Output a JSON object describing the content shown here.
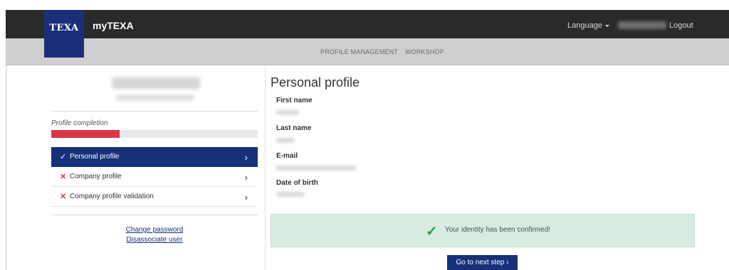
{
  "header": {
    "logo_text": "TEXA",
    "app_title": "myTEXA",
    "language_label": "Language",
    "logout_label": "Logout"
  },
  "subnav": {
    "items": [
      {
        "label": "PROFILE MANAGEMENT"
      },
      {
        "label": "WORKSHOP"
      }
    ]
  },
  "sidebar": {
    "completion_label": "Profile completion",
    "completion_fraction": 0.33,
    "menu": [
      {
        "label": "Personal profile",
        "status": "done",
        "active": true
      },
      {
        "label": "Company profile",
        "status": "missing",
        "active": false
      },
      {
        "label": "Company profile validation",
        "status": "missing",
        "active": false
      }
    ],
    "links": {
      "change_password": "Change password",
      "disassociate_user": "Disassociate user"
    }
  },
  "main": {
    "title": "Personal profile",
    "fields": [
      {
        "label": "First name"
      },
      {
        "label": "Last name"
      },
      {
        "label": "E-mail"
      },
      {
        "label": "Date of birth"
      }
    ],
    "alert_text": "Your identity has been confirmed!",
    "next_button": "Go to next step"
  },
  "colors": {
    "header_bg": "#2a2a2a",
    "logo_bg": "#1b2f79",
    "accent": "#16317a",
    "progress": "#dc3545",
    "success_bg": "#d8ebe1",
    "success_icon": "#2e9b55"
  }
}
